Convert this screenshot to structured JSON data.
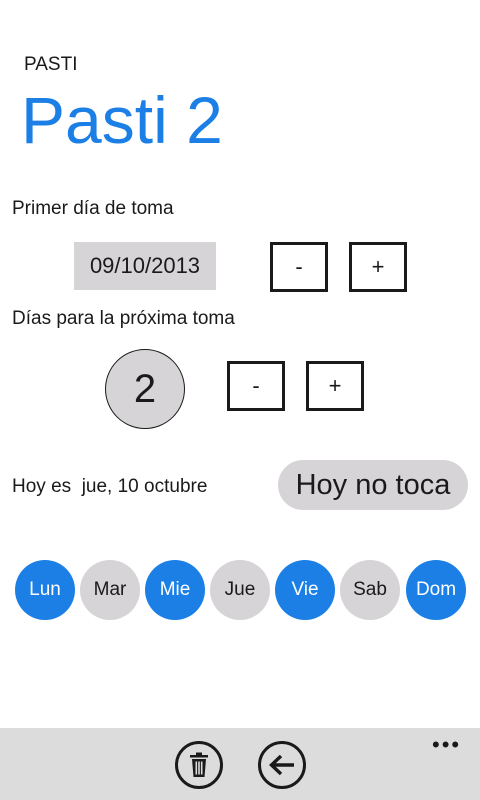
{
  "header": {
    "app_title": "PASTI",
    "page_title": "Pasti 2"
  },
  "first_dose": {
    "label": "Primer día de toma",
    "date": "09/10/2013",
    "minus_label": "-",
    "plus_label": "+"
  },
  "interval": {
    "label": "Días para la próxima toma",
    "value": "2",
    "minus_label": "-",
    "plus_label": "+"
  },
  "today": {
    "prefix": "Hoy es",
    "date": "jue, 10 octubre",
    "status_button": "Hoy no toca"
  },
  "days": [
    {
      "label": "Lun",
      "active": true
    },
    {
      "label": "Mar",
      "active": false
    },
    {
      "label": "Mie",
      "active": true
    },
    {
      "label": "Jue",
      "active": false
    },
    {
      "label": "Vie",
      "active": true
    },
    {
      "label": "Sab",
      "active": false
    },
    {
      "label": "Dom",
      "active": true
    }
  ],
  "appbar": {
    "more": "•••",
    "icons": [
      "trash-icon",
      "back-arrow-icon"
    ]
  },
  "colors": {
    "accent": "#1b7fe6",
    "inactive": "#d6d4d6",
    "appbar": "#dcdcdc"
  }
}
